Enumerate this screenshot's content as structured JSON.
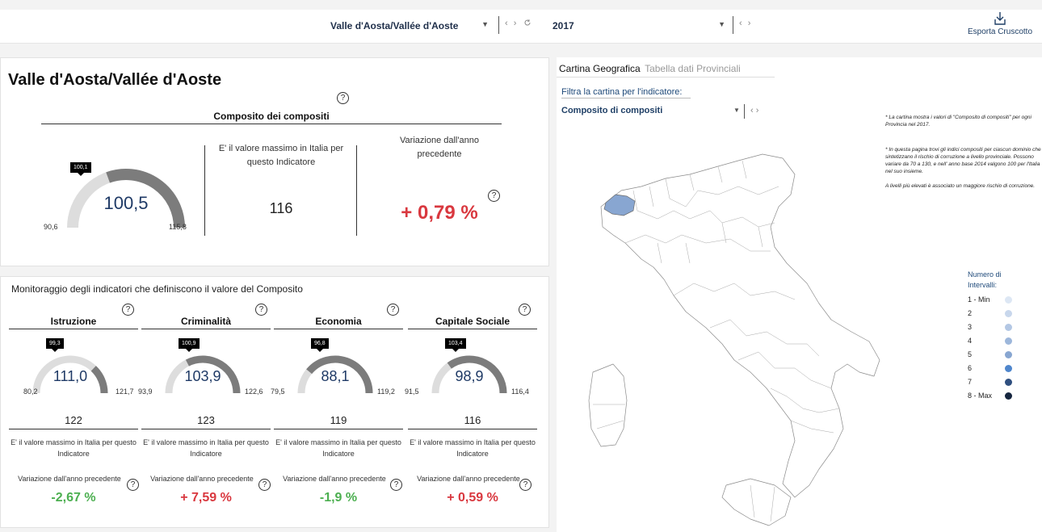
{
  "filters": {
    "region": {
      "value": "Valle d'Aosta/Vallée d'Aoste"
    },
    "year": {
      "value": "2017"
    },
    "arrows": "‹  ›",
    "reset_icon": "refresh-icon",
    "export_label": "Esporta Cruscotto",
    "export_icon": "download-icon"
  },
  "summary": {
    "region_title": "Valle d'Aosta/Vallée d'Aoste",
    "section_title": "Composito dei compositi",
    "help": "?",
    "gauge": {
      "value": "100,5",
      "min": "90,6",
      "max": "115,8",
      "tag": "100,1",
      "fill": 0.39
    },
    "max_label": "E' il valore massimo in Italia per questo Indicatore",
    "max_value": "116",
    "variation_label": "Variazione dall'anno precedente",
    "variation_value": "+ 0,79 %",
    "colors": {
      "gauge_fill": "#7c7c7c",
      "gauge_track": "#dddddd",
      "value": "#1f3a66",
      "negative": "#d9383f",
      "positive": "#4caf50"
    }
  },
  "monitor": {
    "title": "Monitoraggio degli indicatori che definiscono il valore del Composito",
    "items": [
      {
        "name": "Istruzione",
        "value": "111,0",
        "min": "80,2",
        "max": "121,7",
        "tag": "99,3",
        "fill": 0.74,
        "max_value": "122",
        "max_label": "E' il valore massimo in Italia per questo Indicatore",
        "variation_label": "Variazione dall'anno precedente",
        "variation": "-2,67 %",
        "trend": "positive"
      },
      {
        "name": "Criminalità",
        "value": "103,9",
        "min": "93,9",
        "max": "122,6",
        "tag": "100,9",
        "fill": 0.35,
        "max_value": "123",
        "max_label": "E' il valore massimo in Italia per questo Indicatore",
        "variation_label": "Variazione dall'anno precedente",
        "variation": "+ 7,59 %",
        "trend": "negative"
      },
      {
        "name": "Economia",
        "value": "88,1",
        "min": "79,5",
        "max": "119,2",
        "tag": "96,8",
        "fill": 0.22,
        "max_value": "119",
        "max_label": "E' il valore massimo in Italia per questo Indicatore",
        "variation_label": "Variazione dall'anno precedente",
        "variation": "-1,9 %",
        "trend": "positive"
      },
      {
        "name": "Capitale Sociale",
        "value": "98,9",
        "min": "91,5",
        "max": "116,4",
        "tag": "103,4",
        "fill": 0.3,
        "max_value": "116",
        "max_label": "E' il valore massimo in Italia per questo Indicatore",
        "variation_label": "Variazione dall'anno precedente",
        "variation": "+ 0,59 %",
        "trend": "negative"
      }
    ]
  },
  "map": {
    "tab_active": "Cartina Geografica",
    "tab_inactive": "Tabella dati Provinciali",
    "filter_label": "Filtra la cartina per l'indicatore:",
    "filter_value": "Composito di compositi",
    "note1": "* La cartina mostra i valori di \"Composito di compositi\" per ogni Provincia nel 2017.",
    "note2": "* In questa pagina trovi gli indici compositi per ciascun dominio che sintetizzano il rischio di corruzione a livello provinciale. Possono variare da 70 a 130, e nell' anno base 2014 valgono 100 per l'Italia nel suo insieme.",
    "note3": "A livelli più elevati è associato un maggiore rischio di corruzione.",
    "legend_title_1": "Numero di",
    "legend_title_2": "Intervalli:",
    "legend": [
      {
        "label": "1 - Min",
        "color": "#dde7f4"
      },
      {
        "label": "2",
        "color": "#c8d7ec"
      },
      {
        "label": "3",
        "color": "#b3c7e4"
      },
      {
        "label": "4",
        "color": "#9db7db"
      },
      {
        "label": "5",
        "color": "#88a6d1"
      },
      {
        "label": "6",
        "color": "#4f86cc"
      },
      {
        "label": "7",
        "color": "#2f4f7f"
      },
      {
        "label": "8 - Max",
        "color": "#16263f"
      }
    ],
    "highlight_color": "#88a6d1"
  }
}
